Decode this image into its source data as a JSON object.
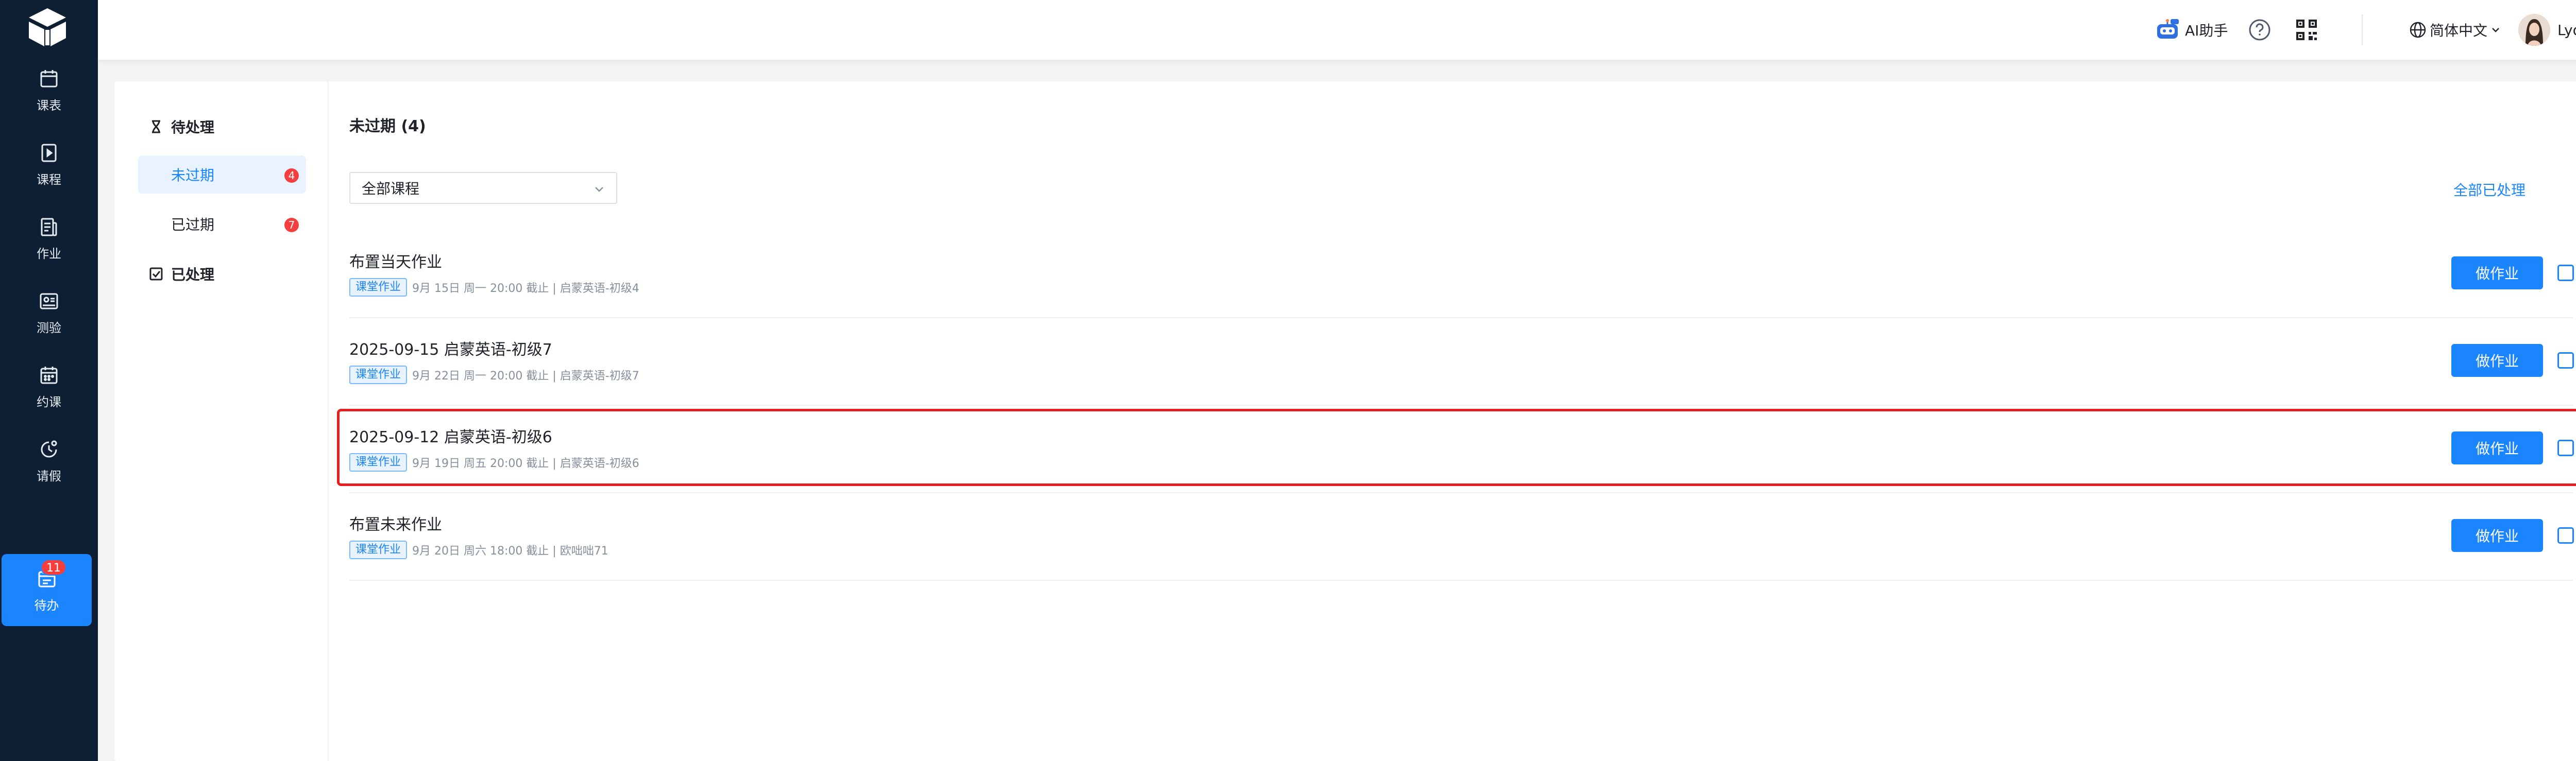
{
  "nav": {
    "items": [
      {
        "label": "课表",
        "icon": "calendar-icon"
      },
      {
        "label": "课程",
        "icon": "course-book-icon"
      },
      {
        "label": "作业",
        "icon": "homework-doc-icon"
      },
      {
        "label": "测验",
        "icon": "quiz-card-icon"
      },
      {
        "label": "约课",
        "icon": "booking-calendar-icon"
      },
      {
        "label": "请假",
        "icon": "leave-clock-icon"
      },
      {
        "label": "待办",
        "icon": "todo-calendar-icon",
        "badge": "11",
        "active": true
      }
    ]
  },
  "header": {
    "ai_label": "AI助手",
    "language": "简体中文",
    "username": "Lydia"
  },
  "subnav": {
    "pending_label": "待处理",
    "not_expired": {
      "label": "未过期",
      "count": "4"
    },
    "expired": {
      "label": "已过期",
      "count": "7"
    },
    "processed_label": "已处理"
  },
  "content": {
    "title": "未过期 (4)",
    "course_filter": "全部课程",
    "mark_all": "全部已处理",
    "do_label": "做作业",
    "rows": [
      {
        "title": "布置当天作业",
        "tag": "课堂作业",
        "meta": "9月 15日 周一 20:00 截止 | 启蒙英语-初级4"
      },
      {
        "title": "2025-09-15 启蒙英语-初级7",
        "tag": "课堂作业",
        "meta": "9月 22日 周一 20:00 截止 | 启蒙英语-初级7"
      },
      {
        "title": "2025-09-12 启蒙英语-初级6",
        "tag": "课堂作业",
        "meta": "9月 19日 周五 20:00 截止 | 启蒙英语-初级6"
      },
      {
        "title": "布置未来作业",
        "tag": "课堂作业",
        "meta": "9月 20日 周六 18:00 截止 | 欧咄咄71"
      }
    ]
  },
  "colors": {
    "rail_bg": "#0f1f33",
    "accent": "#1a85ff",
    "badge_red": "#f53f3f",
    "highlight_red": "#e81e1e"
  }
}
